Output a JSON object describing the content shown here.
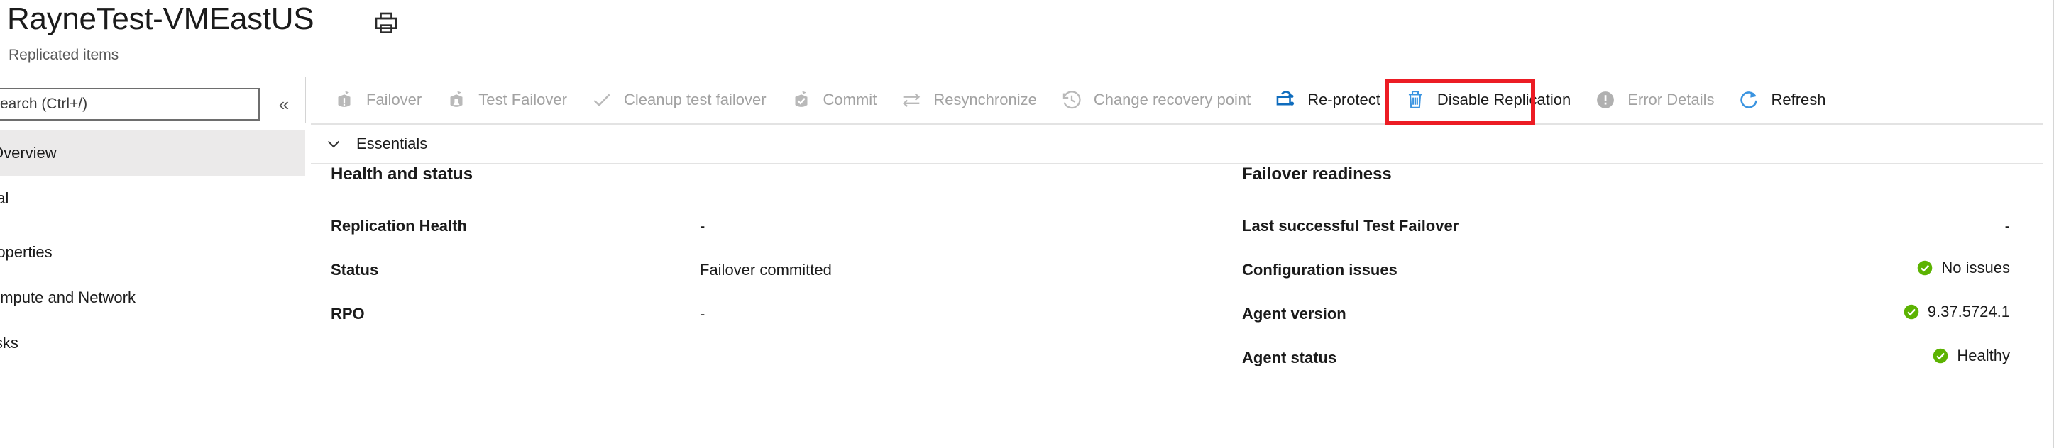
{
  "header": {
    "title": "RayneTest-VMEastUS",
    "breadcrumb": "Replicated items",
    "print_icon": "print-icon"
  },
  "sidebar": {
    "search": {
      "value": "",
      "placeholder": "earch (Ctrl+/)",
      "icon": "search-icon"
    },
    "collapse_icon_glyph": "«",
    "items": [
      {
        "label": "Overview",
        "selected": true
      },
      {
        "label": "ral",
        "selected": false
      },
      {
        "label": "roperties",
        "selected": false
      },
      {
        "label": "ompute and Network",
        "selected": false
      },
      {
        "label": "isks",
        "selected": false
      }
    ]
  },
  "toolbar": {
    "commands": [
      {
        "label": "Failover",
        "icon": "failover-icon",
        "enabled": false,
        "highlighted": false
      },
      {
        "label": "Test Failover",
        "icon": "test-failover-icon",
        "enabled": false,
        "highlighted": false
      },
      {
        "label": "Cleanup test failover",
        "icon": "checkmark-icon",
        "enabled": false,
        "highlighted": false
      },
      {
        "label": "Commit",
        "icon": "commit-icon",
        "enabled": false,
        "highlighted": false
      },
      {
        "label": "Resynchronize",
        "icon": "resynchronize-icon",
        "enabled": false,
        "highlighted": false
      },
      {
        "label": "Change recovery point",
        "icon": "clock-history-icon",
        "enabled": false,
        "highlighted": false
      },
      {
        "label": "Re-protect",
        "icon": "re-protect-icon",
        "enabled": true,
        "highlighted": true
      },
      {
        "label": "Disable Replication",
        "icon": "trash-icon",
        "enabled": true,
        "highlighted": false
      },
      {
        "label": "Error Details",
        "icon": "error-circle-icon",
        "enabled": false,
        "highlighted": false
      },
      {
        "label": "Refresh",
        "icon": "refresh-icon",
        "enabled": true,
        "highlighted": false
      }
    ],
    "highlight_color": "#ec1c24"
  },
  "essentials": {
    "label": "Essentials",
    "chevron_icon": "chevron-down-icon",
    "expanded": true
  },
  "panels": {
    "health_and_status": {
      "heading": "Health and status",
      "rows": [
        {
          "key": "Replication Health",
          "value": "-"
        },
        {
          "key": "Status",
          "value": "Failover committed"
        },
        {
          "key": "RPO",
          "value": "-"
        }
      ]
    },
    "failover_readiness": {
      "heading": "Failover readiness",
      "rows": [
        {
          "key": "Last successful Test Failover",
          "value": "-",
          "status_icon": null
        },
        {
          "key": "Configuration issues",
          "value": "No issues",
          "status_icon": "success-check-icon"
        },
        {
          "key": "Agent version",
          "value": "9.37.5724.1",
          "status_icon": "success-check-icon"
        },
        {
          "key": "Agent status",
          "value": "Healthy",
          "status_icon": "success-check-icon"
        }
      ]
    }
  },
  "colors": {
    "success_green": "#5cb302",
    "link_blue": "#0078d4",
    "disabled_gray": "#a2a2a2",
    "selected_row": "#ebeaea"
  }
}
